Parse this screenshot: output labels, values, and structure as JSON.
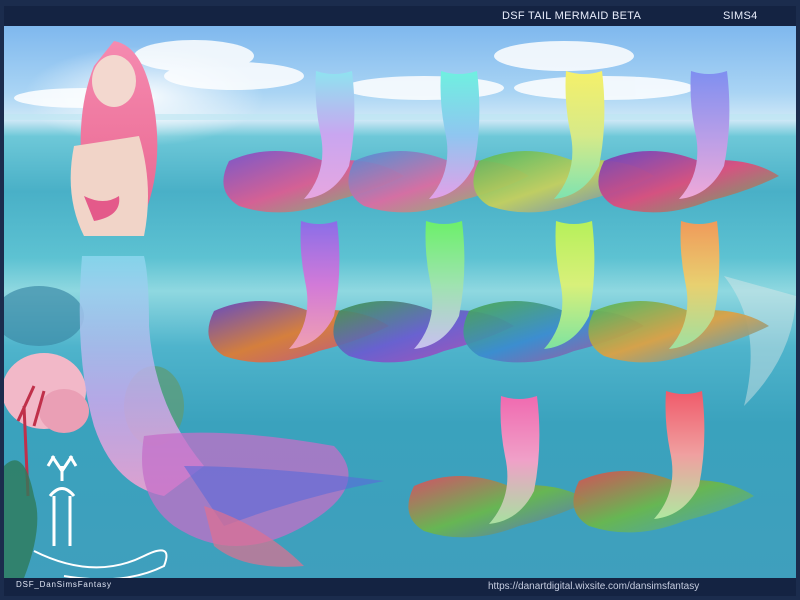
{
  "header": {
    "title": "DSF TAIL MERMAID BETA",
    "game": "SIMS4"
  },
  "footer": {
    "credit": "DSF_DanSimsFantasy",
    "url": "https://danartdigital.wixsite.com/dansimsfantasy"
  },
  "icons": {
    "logo": "deer-logo-icon"
  },
  "swatches": [
    {
      "tail": [
        "#8fe3f0",
        "#c9a6f0",
        "#e7a6e0"
      ],
      "fin": [
        "#7b4fc9",
        "#e05a90",
        "#6bc86a"
      ]
    },
    {
      "tail": [
        "#6ff0e0",
        "#8fc6f0",
        "#e3a0e8"
      ],
      "fin": [
        "#4a8fd8",
        "#e06aa0",
        "#7acb5a"
      ]
    },
    {
      "tail": [
        "#f5f06a",
        "#d7ea88",
        "#7ee3b0"
      ],
      "fin": [
        "#4fb85a",
        "#c9d05a",
        "#5a7ad0"
      ]
    },
    {
      "tail": [
        "#7f8ff0",
        "#b79ee8",
        "#f0a8d8"
      ],
      "fin": [
        "#6a3ec0",
        "#e04a7a",
        "#5ab85a"
      ]
    },
    {
      "tail": [
        "#8a6ee8",
        "#d27ad8",
        "#f0a0b0"
      ],
      "fin": [
        "#6040c0",
        "#e07a30",
        "#c04a90"
      ]
    },
    {
      "tail": [
        "#6cf06a",
        "#9fe3b0",
        "#c8c0f0"
      ],
      "fin": [
        "#3a9a4a",
        "#6a5ad0",
        "#c04ab0"
      ]
    },
    {
      "tail": [
        "#b6f05a",
        "#d8f07a",
        "#7ee3a0"
      ],
      "fin": [
        "#4aa84a",
        "#3a8ad0",
        "#c04a90"
      ]
    },
    {
      "tail": [
        "#f09a5a",
        "#e8d070",
        "#9fe0a0"
      ],
      "fin": [
        "#4ab85a",
        "#e0a040",
        "#3a9ad0"
      ]
    },
    {
      "tail": [
        "#f06ab0",
        "#f0a0c8",
        "#a8e0a0"
      ],
      "fin": [
        "#e04a60",
        "#6ab84a",
        "#5a6ad0"
      ]
    },
    {
      "tail": [
        "#f05a6a",
        "#f0a0a0",
        "#b0e8a0"
      ],
      "fin": [
        "#e04a50",
        "#6ab84a",
        "#4aa0c0"
      ]
    }
  ]
}
